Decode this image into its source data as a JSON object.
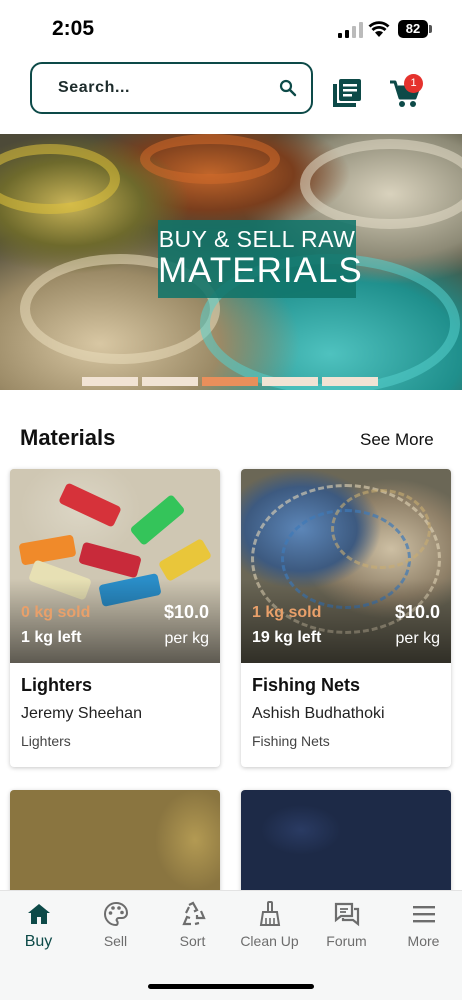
{
  "status_bar": {
    "time": "2:05",
    "battery": "82"
  },
  "header": {
    "search_placeholder": "Search...",
    "cart_count": "1",
    "icons": [
      "search-icon",
      "catalog-icon",
      "cart-icon"
    ]
  },
  "banner": {
    "line1": "BUY & SELL RAW",
    "line2": "MATERIALS",
    "slides": 5,
    "active_slide": 3
  },
  "section": {
    "title": "Materials",
    "see_more": "See More"
  },
  "cards": [
    {
      "sold": "0 kg sold",
      "left": "1 kg left",
      "price": "$10.0",
      "unit": "per kg",
      "name": "Lighters",
      "seller": "Jeremy Sheehan",
      "category": "Lighters"
    },
    {
      "sold": "1 kg sold",
      "left": "19 kg left",
      "price": "$10.0",
      "unit": "per kg",
      "name": "Fishing Nets",
      "seller": "Ashish Budhathoki",
      "category": "Fishing Nets"
    }
  ],
  "nav": {
    "items": [
      {
        "label": "Buy",
        "icon": "home-icon"
      },
      {
        "label": "Sell",
        "icon": "palette-icon"
      },
      {
        "label": "Sort",
        "icon": "recycle-icon"
      },
      {
        "label": "Clean Up",
        "icon": "broom-icon"
      },
      {
        "label": "Forum",
        "icon": "forum-icon"
      },
      {
        "label": "More",
        "icon": "menu-icon"
      }
    ],
    "active": "Buy"
  },
  "colors": {
    "brand": "#0d4a48",
    "badge": "#e5322d",
    "sold": "#e9a06a",
    "active_dot": "#e98f5b",
    "dot": "#f1e3d4"
  }
}
